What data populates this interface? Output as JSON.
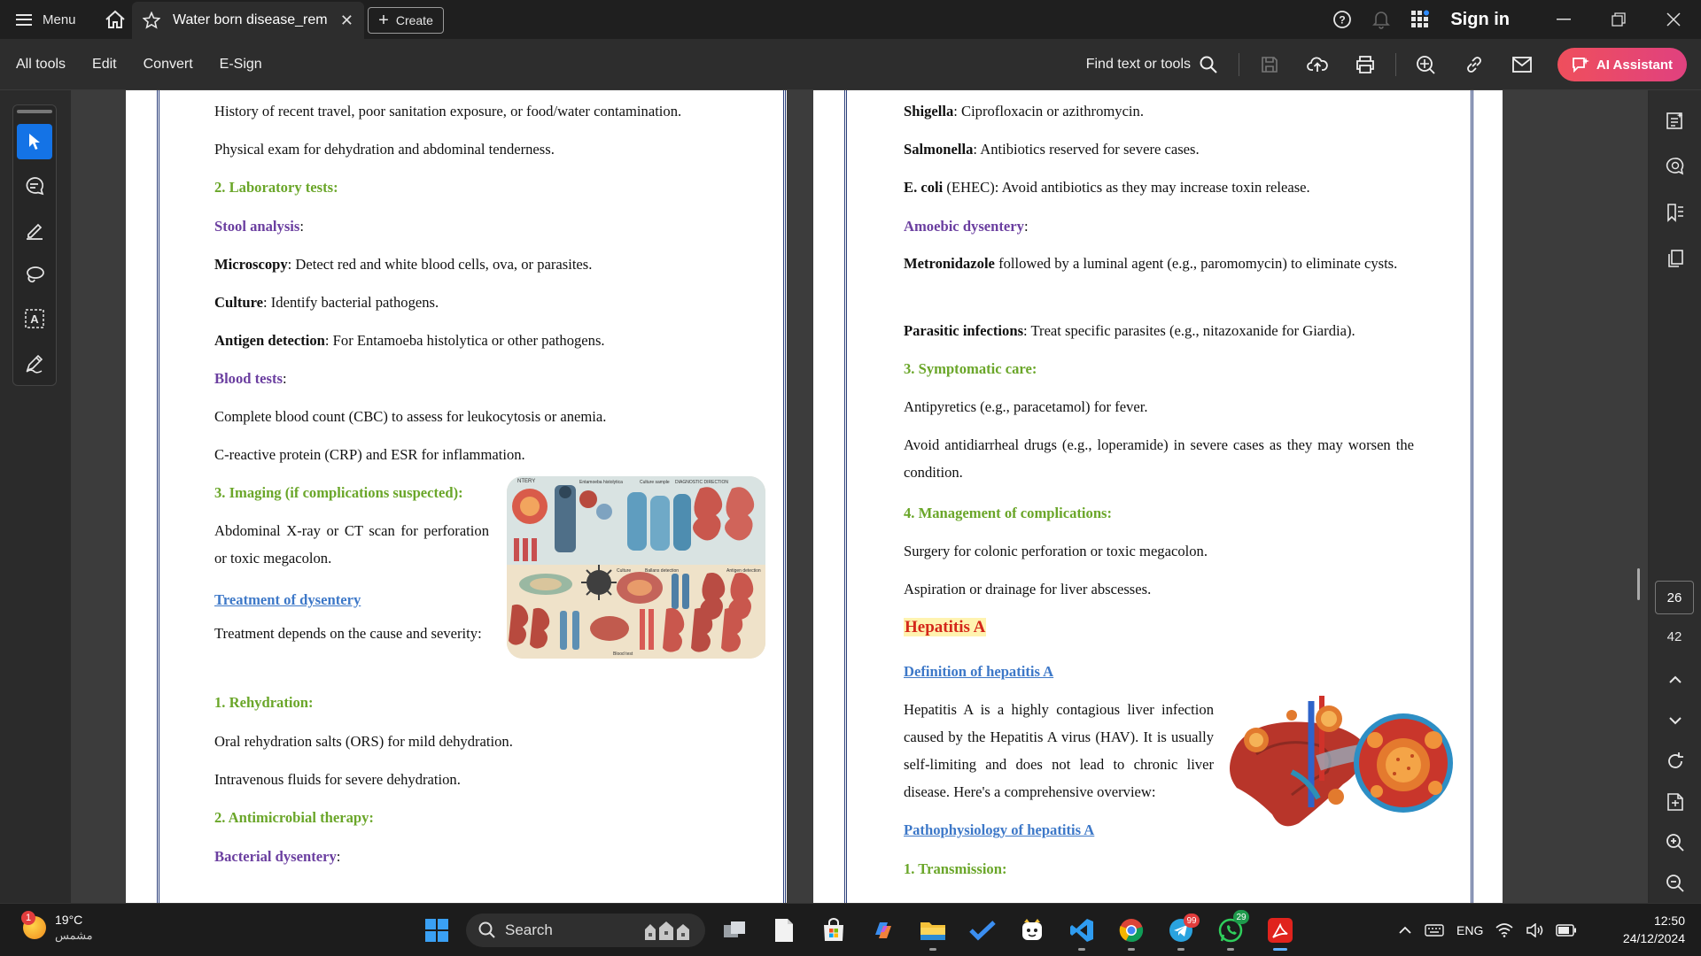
{
  "titlebar": {
    "menu_label": "Menu",
    "tab_title": "Water born disease_rem...",
    "create_label": "Create",
    "sign_in": "Sign in"
  },
  "toolbar": {
    "menus": [
      "All tools",
      "Edit",
      "Convert",
      "E-Sign"
    ],
    "find_label": "Find text or tools",
    "ai_label": "AI Assistant"
  },
  "left_page": {
    "l1": "History of recent travel, poor sanitation exposure, or food/water contamination.",
    "l2": "Physical exam for dehydration and abdominal tenderness.",
    "l3": "2. Laboratory tests:",
    "l4": "Stool analysis",
    "l5_b": "Microscopy",
    "l5": ": Detect red and white blood cells, ova, or parasites.",
    "l6_b": "Culture",
    "l6": ": Identify bacterial pathogens.",
    "l7_b": "Antigen detection",
    "l7": ": For Entamoeba histolytica or other pathogens.",
    "l8": "Blood tests",
    "l9": "Complete blood count (CBC) to assess for leukocytosis or anemia.",
    "l10": "C-reactive protein (CRP) and ESR for inflammation.",
    "l11": "3. Imaging (if complications suspected):",
    "l12": "Abdominal X-ray or CT scan for perforation or toxic megacolon.",
    "l13": "Treatment of dysentery",
    "l14": "Treatment depends on the cause and severity:",
    "l15": "1. Rehydration:",
    "l16": "Oral rehydration salts (ORS) for mild dehydration.",
    "l17": "Intravenous fluids for severe dehydration.",
    "l18": "2. Antimicrobial therapy:",
    "l19": "Bacterial dysentery",
    "illus_title": "NTERY",
    "illus_labels": [
      "Entamoeba histolytica",
      "Culture sample",
      "DIAGNOSTIC DIRECTION",
      "Culture",
      "Ballans detection",
      "Antigen detection",
      "Blood test"
    ]
  },
  "right_page": {
    "r1_b": "Shigella",
    "r1": ": Ciprofloxacin or azithromycin.",
    "r2_b": "Salmonella",
    "r2": ": Antibiotics reserved for severe cases.",
    "r3_b": "E. coli",
    "r3": " (EHEC): Avoid antibiotics as they may increase toxin release.",
    "r4": "Amoebic dysentery",
    "r5_b": "Metronidazole",
    "r5": " followed by a luminal agent (e.g., paromomycin) to eliminate cysts.",
    "r6_b": "Parasitic infections",
    "r6": ": Treat specific parasites (e.g., nitazoxanide for Giardia).",
    "r7": "3. Symptomatic care:",
    "r8": "Antipyretics (e.g., paracetamol) for fever.",
    "r9": "Avoid antidiarrheal drugs (e.g., loperamide) in severe cases as they may worsen the condition.",
    "r10": "4. Management of complications:",
    "r11": "Surgery for colonic perforation or toxic megacolon.",
    "r12": "Aspiration or drainage for liver abscesses.",
    "r13": "Hepatitis A",
    "r14": "Definition of hepatitis A",
    "r15": "Hepatitis A is a highly contagious liver infection caused by the Hepatitis A virus (HAV). It is usually self-limiting and does not lead to chronic liver disease. Here's a comprehensive overview:",
    "r16": "Pathophysiology of hepatitis A",
    "r17": "1. Transmission:"
  },
  "page_nav": {
    "current": "26",
    "total": "42"
  },
  "taskbar": {
    "weather_temp": "19°C",
    "weather_desc": "مشمس",
    "weather_badge": "1",
    "search_label": "Search",
    "telegram_badge": "99",
    "whatsapp_badge": "29",
    "lang": "ENG",
    "time": "12:50",
    "date": "24/12/2024"
  },
  "colors": {
    "accent": "#1473e6",
    "heading_green": "#6aa629",
    "heading_purple": "#6b3fa0",
    "heading_blue": "#3d78c8",
    "hepatitis_red": "#d4271a",
    "ai_gradient": "#ef4f5c"
  },
  "icons": [
    "menu-icon",
    "home-icon",
    "star-icon",
    "help-icon",
    "bell-icon",
    "apps-icon",
    "search-icon",
    "save-icon",
    "upload-icon",
    "print-icon",
    "ai-search-icon",
    "link-icon",
    "mail-icon",
    "cursor-icon",
    "comment-icon",
    "highlight-icon",
    "lasso-icon",
    "text-select-icon",
    "sign-icon"
  ]
}
